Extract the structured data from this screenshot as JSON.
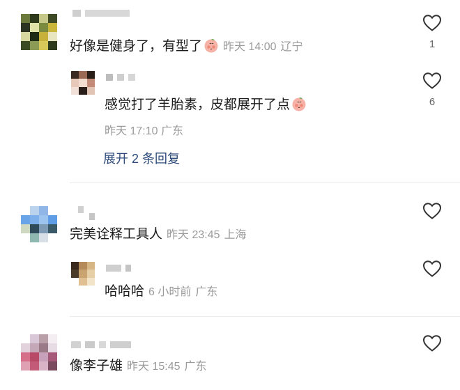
{
  "comments": [
    {
      "text": "好像是健身了，有型了",
      "emoji": "peach-face-emoji",
      "time": "昨天 14:00",
      "location": "辽宁",
      "likes": "1",
      "reply": {
        "text": "感觉打了羊胎素，皮都展开了点",
        "emoji": "peach-face-emoji",
        "time": "昨天 17:10",
        "location": "广东",
        "likes": "6"
      },
      "expand_label": "展开 2 条回复"
    },
    {
      "text": "完美诠释工具人",
      "time": "昨天 23:45",
      "location": "上海",
      "reply": {
        "text": "哈哈哈",
        "time": "6 小时前",
        "location": "广东"
      }
    },
    {
      "text": "像李子雄",
      "time": "昨天 15:45",
      "location": "广东"
    }
  ],
  "icons": {
    "like": "heart-outline-icon"
  }
}
